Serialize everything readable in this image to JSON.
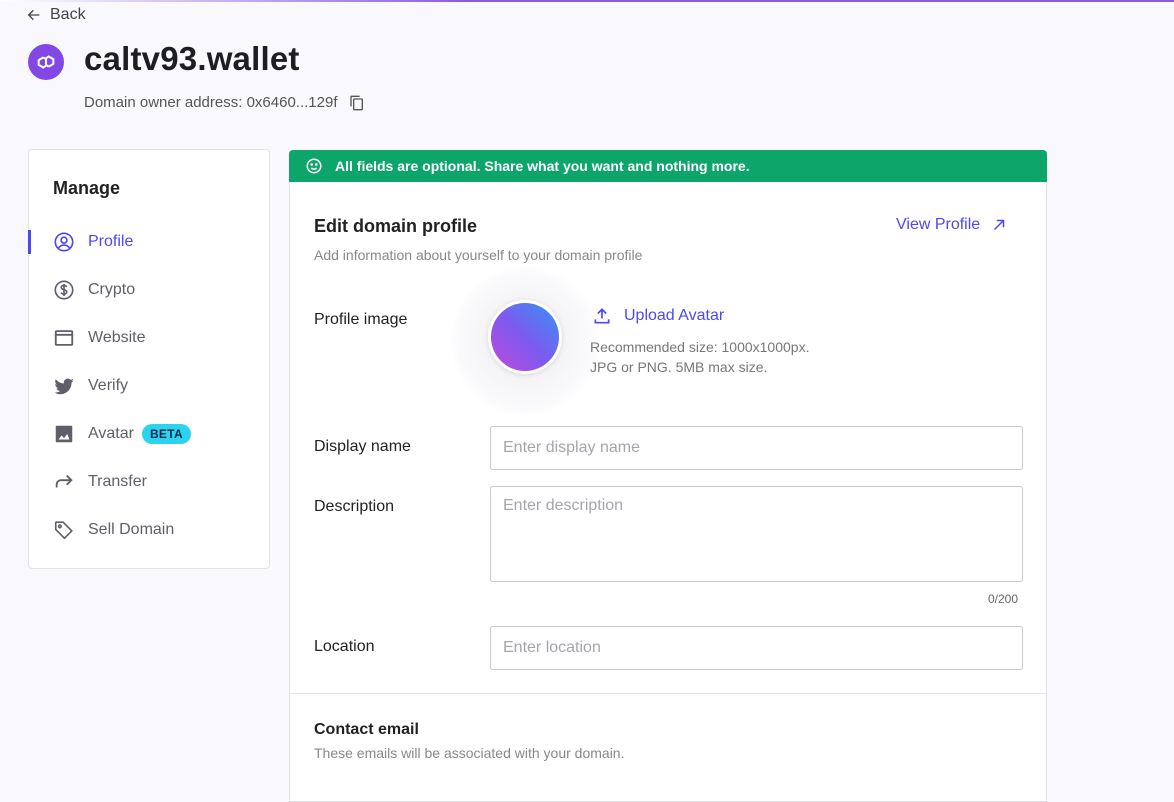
{
  "header": {
    "back_label": "Back",
    "domain_name": "caltv93.wallet",
    "owner_address": "Domain owner address: 0x6460...129f"
  },
  "sidebar": {
    "title": "Manage",
    "items": [
      {
        "label": "Profile",
        "icon": "account-circle-icon",
        "active": true
      },
      {
        "label": "Crypto",
        "icon": "dollar-circle-icon",
        "active": false
      },
      {
        "label": "Website",
        "icon": "browser-window-icon",
        "active": false
      },
      {
        "label": "Verify",
        "icon": "twitter-icon",
        "active": false
      },
      {
        "label": "Avatar",
        "icon": "image-icon",
        "active": false,
        "badge": "BETA"
      },
      {
        "label": "Transfer",
        "icon": "forward-arrow-icon",
        "active": false
      },
      {
        "label": "Sell Domain",
        "icon": "tag-icon",
        "active": false
      }
    ]
  },
  "banner": {
    "text": "All fields are optional. Share what you want and nothing more."
  },
  "profile": {
    "title": "Edit domain profile",
    "subtitle": "Add information about yourself to your domain profile",
    "view_profile_label": "View Profile",
    "profile_image_label": "Profile image",
    "upload_label": "Upload Avatar",
    "hint_size": "Recommended size: 1000x1000px.",
    "hint_format": "JPG or PNG. 5MB max size.",
    "display_name_label": "Display name",
    "display_name_value": "",
    "display_name_placeholder": "Enter display name",
    "description_label": "Description",
    "description_value": "",
    "description_placeholder": "Enter description",
    "description_counter": "0/200",
    "location_label": "Location",
    "location_value": "",
    "location_placeholder": "Enter location"
  },
  "contact": {
    "title": "Contact email",
    "subtitle": "These emails will be associated with your domain."
  },
  "colors": {
    "accent": "#4c47f7",
    "banner_green": "#0ea56a",
    "polygon_purple": "#8247e5",
    "beta_badge": "#2bd3ef"
  }
}
